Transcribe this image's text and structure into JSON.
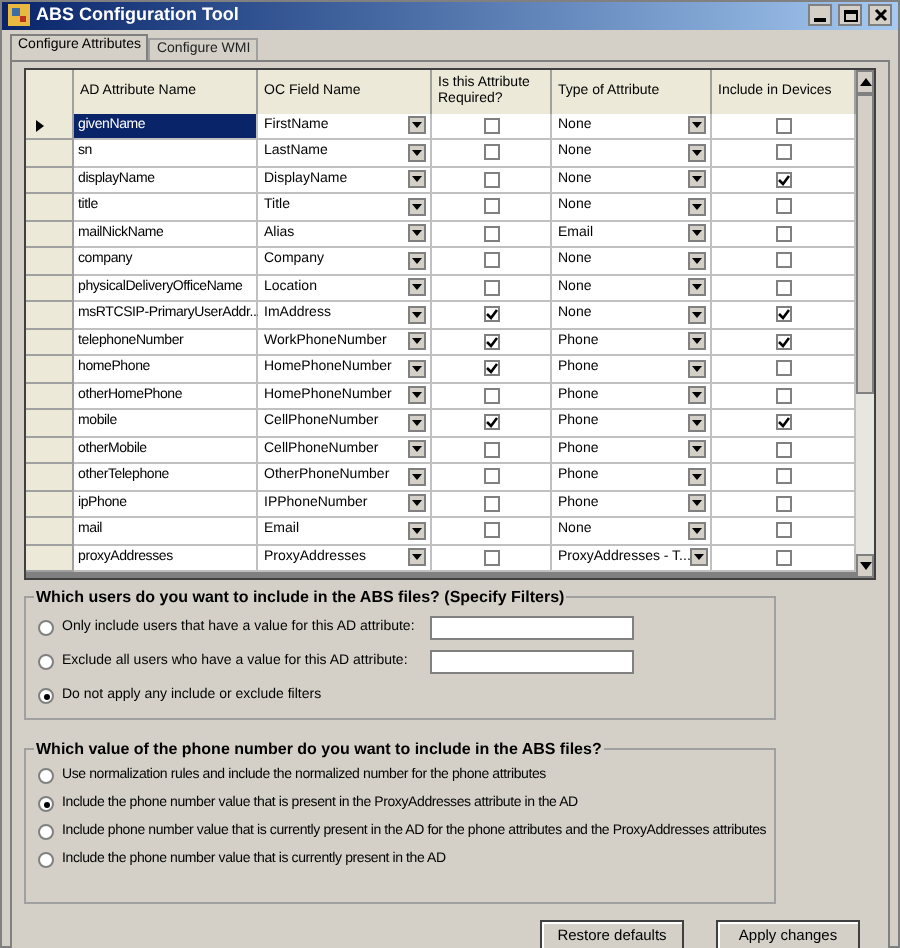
{
  "window": {
    "title": "ABS Configuration Tool"
  },
  "tabs": [
    {
      "label": "Configure Attributes",
      "selected": true
    },
    {
      "label": "Configure WMI",
      "selected": false
    }
  ],
  "grid": {
    "columns": [
      "AD Attribute Name",
      "OC Field Name",
      "Is this Attribute Required?",
      "Type of Attribute",
      "Include in Devices"
    ],
    "rows": [
      {
        "ad": "givenName",
        "oc": "FirstName",
        "required": false,
        "type": "None",
        "include": false,
        "selected": true
      },
      {
        "ad": "sn",
        "oc": "LastName",
        "required": false,
        "type": "None",
        "include": false,
        "selected": false
      },
      {
        "ad": "displayName",
        "oc": "DisplayName",
        "required": false,
        "type": "None",
        "include": true,
        "selected": false
      },
      {
        "ad": "title",
        "oc": "Title",
        "required": false,
        "type": "None",
        "include": false,
        "selected": false
      },
      {
        "ad": "mailNickName",
        "oc": "Alias",
        "required": false,
        "type": "Email",
        "include": false,
        "selected": false
      },
      {
        "ad": "company",
        "oc": "Company",
        "required": false,
        "type": "None",
        "include": false,
        "selected": false
      },
      {
        "ad": "physicalDeliveryOfficeName",
        "oc": "Location",
        "required": false,
        "type": "None",
        "include": false,
        "selected": false
      },
      {
        "ad": "msRTCSIP-PrimaryUserAddr...",
        "oc": "ImAddress",
        "required": true,
        "type": "None",
        "include": true,
        "selected": false
      },
      {
        "ad": "telephoneNumber",
        "oc": "WorkPhoneNumber",
        "required": true,
        "type": "Phone",
        "include": true,
        "selected": false
      },
      {
        "ad": "homePhone",
        "oc": "HomePhoneNumber",
        "required": true,
        "type": "Phone",
        "include": false,
        "selected": false
      },
      {
        "ad": "otherHomePhone",
        "oc": "HomePhoneNumber",
        "required": false,
        "type": "Phone",
        "include": false,
        "selected": false
      },
      {
        "ad": "mobile",
        "oc": "CellPhoneNumber",
        "required": true,
        "type": "Phone",
        "include": true,
        "selected": false
      },
      {
        "ad": "otherMobile",
        "oc": "CellPhoneNumber",
        "required": false,
        "type": "Phone",
        "include": false,
        "selected": false
      },
      {
        "ad": "otherTelephone",
        "oc": "OtherPhoneNumber",
        "required": false,
        "type": "Phone",
        "include": false,
        "selected": false
      },
      {
        "ad": "ipPhone",
        "oc": "IPPhoneNumber",
        "required": false,
        "type": "Phone",
        "include": false,
        "selected": false
      },
      {
        "ad": "mail",
        "oc": "Email",
        "required": false,
        "type": "None",
        "include": false,
        "selected": false
      },
      {
        "ad": "proxyAddresses",
        "oc": "ProxyAddresses",
        "required": false,
        "type": "ProxyAddresses - T...",
        "include": false,
        "selected": false
      }
    ]
  },
  "filters": {
    "title": "Which users do you want to include in the ABS files? (Specify Filters)",
    "options": [
      {
        "label": "Only include users that have a value for this AD attribute:",
        "selected": false,
        "kind": "field"
      },
      {
        "label": "Exclude all users who have a value for this AD attribute:",
        "selected": false,
        "kind": "field"
      },
      {
        "label": "Do not apply any include or exclude filters",
        "selected": true,
        "kind": "plain"
      }
    ]
  },
  "phone": {
    "title": "Which value of the phone number do you want to include in the ABS files?",
    "options": [
      {
        "label": "Use normalization rules and include the normalized number for the phone attributes",
        "selected": false
      },
      {
        "label": "Include the phone number value that is present in the ProxyAddresses attribute in the AD",
        "selected": true
      },
      {
        "label": "Include phone number value that is currently present in the AD for the phone attributes and the ProxyAddresses attributes",
        "selected": false
      },
      {
        "label": "Include the phone number value that is currently present in the AD",
        "selected": false
      }
    ]
  },
  "buttons": [
    "Restore defaults",
    "Apply changes"
  ]
}
